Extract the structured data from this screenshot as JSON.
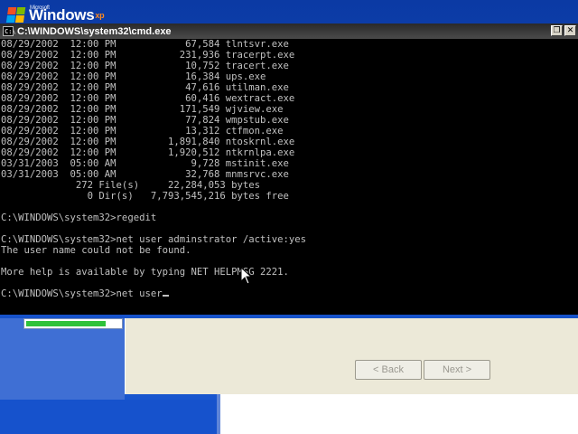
{
  "desktop": {
    "logo": {
      "microsoft": "Microsoft",
      "windows": "Windows",
      "edition": "xp"
    }
  },
  "wizard": {
    "progress": 0.85,
    "back_label": "< Back",
    "next_label": "Next >"
  },
  "cmd": {
    "title": "C:\\WINDOWS\\system32\\cmd.exe",
    "lines": [
      "08/29/2002  12:00 PM            67,584 tlntsvr.exe",
      "08/29/2002  12:00 PM           231,936 tracerpt.exe",
      "08/29/2002  12:00 PM            10,752 tracert.exe",
      "08/29/2002  12:00 PM            16,384 ups.exe",
      "08/29/2002  12:00 PM            47,616 utilman.exe",
      "08/29/2002  12:00 PM            60,416 wextract.exe",
      "08/29/2002  12:00 PM           171,549 wjview.exe",
      "08/29/2002  12:00 PM            77,824 wmpstub.exe",
      "08/29/2002  12:00 PM            13,312 ctfmon.exe",
      "08/29/2002  12:00 PM         1,891,840 ntoskrnl.exe",
      "08/29/2002  12:00 PM         1,920,512 ntkrnlpa.exe",
      "03/31/2003  05:00 AM             9,728 mstinit.exe",
      "03/31/2003  05:00 AM            32,768 mnmsrvc.exe",
      "             272 File(s)     22,284,053 bytes",
      "               0 Dir(s)   7,793,545,216 bytes free",
      "",
      "C:\\WINDOWS\\system32>regedit",
      "",
      "C:\\WINDOWS\\system32>net user adminstrator /active:yes",
      "The user name could not be found.",
      "",
      "More help is available by typing NET HELPMSG 2221.",
      "",
      "C:\\WINDOWS\\system32>net user"
    ]
  }
}
